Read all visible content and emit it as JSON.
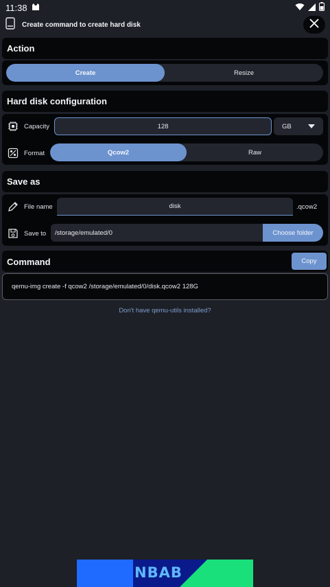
{
  "status_bar": {
    "time": "11:38"
  },
  "app_bar": {
    "title": "Create command to create hard disk"
  },
  "action": {
    "heading": "Action",
    "options": [
      "Create",
      "Resize"
    ],
    "selected": "Create"
  },
  "hard_disk": {
    "heading": "Hard disk configuration",
    "capacity_label": "Capacity",
    "capacity_value": "128",
    "unit": "GB",
    "format_label": "Format",
    "format_options": [
      "Qcow2",
      "Raw"
    ],
    "format_selected": "Qcow2"
  },
  "save_as": {
    "heading": "Save as",
    "file_name_label": "File name",
    "file_name_value": "disk",
    "extension": ".qcow2",
    "save_to_label": "Save to",
    "save_to_value": "/storage/emulated/0",
    "choose_folder_label": "Choose folder"
  },
  "command": {
    "heading": "Command",
    "copy_label": "Copy",
    "text": "qemu-img create -f qcow2 /storage/emulated/0/disk.qcow2 128G"
  },
  "help_link": "Don't have qemu-utils installed?",
  "banner": {
    "text": "NBAB",
    "colors": [
      "#1f6bff",
      "#0a1a8a",
      "#19e07a"
    ]
  }
}
